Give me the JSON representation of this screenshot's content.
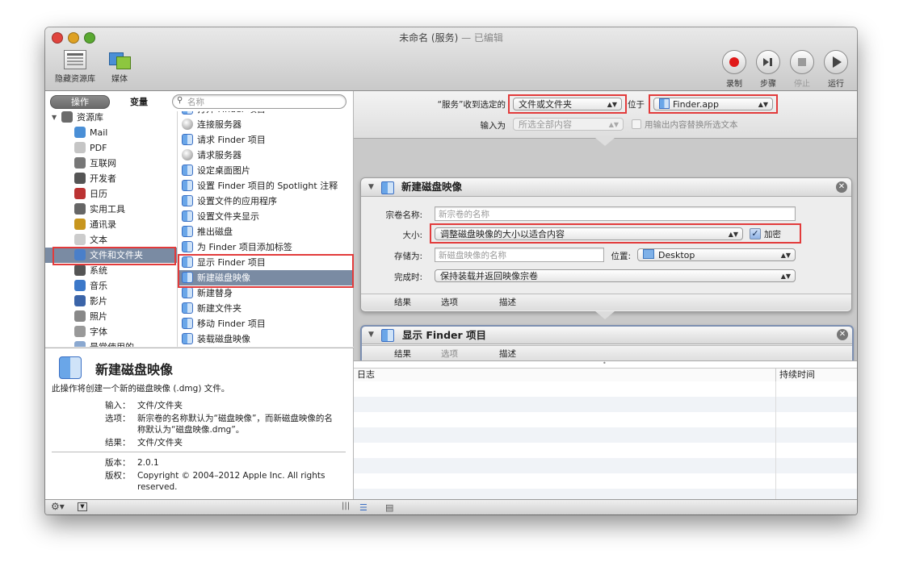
{
  "window": {
    "title": "未命名 (服务)",
    "title_suffix": " — 已编辑"
  },
  "toolbar": {
    "hide_library": "隐藏资源库",
    "media": "媒体",
    "record": "录制",
    "step": "步骤",
    "stop": "停止",
    "run": "运行"
  },
  "library": {
    "tab_actions": "操作",
    "tab_variables": "变量",
    "search_placeholder": "名称",
    "categories": [
      {
        "label": "资源库",
        "icon": "library-icon"
      },
      {
        "label": "Mail",
        "icon": "mail-icon"
      },
      {
        "label": "PDF",
        "icon": "pdf-icon"
      },
      {
        "label": "互联网",
        "icon": "internet-icon"
      },
      {
        "label": "开发者",
        "icon": "developer-icon"
      },
      {
        "label": "日历",
        "icon": "calendar-icon"
      },
      {
        "label": "实用工具",
        "icon": "utilities-icon"
      },
      {
        "label": "通讯录",
        "icon": "contacts-icon"
      },
      {
        "label": "文本",
        "icon": "text-icon"
      },
      {
        "label": "文件和文件夹",
        "icon": "files-folders-icon"
      },
      {
        "label": "系统",
        "icon": "system-icon"
      },
      {
        "label": "音乐",
        "icon": "music-icon"
      },
      {
        "label": "影片",
        "icon": "movies-icon"
      },
      {
        "label": "照片",
        "icon": "photos-icon"
      },
      {
        "label": "字体",
        "icon": "fonts-icon"
      },
      {
        "label": "最常使用的",
        "icon": "folder-icon"
      }
    ],
    "actions": [
      {
        "label": "打开 Finder 项目",
        "icon": "finder-icon"
      },
      {
        "label": "连接服务器",
        "icon": "globe-icon"
      },
      {
        "label": "请求 Finder 项目",
        "icon": "finder-icon"
      },
      {
        "label": "请求服务器",
        "icon": "globe-icon"
      },
      {
        "label": "设定桌面图片",
        "icon": "finder-icon"
      },
      {
        "label": "设置 Finder 项目的 Spotlight 注释",
        "icon": "finder-icon"
      },
      {
        "label": "设置文件的应用程序",
        "icon": "finder-icon"
      },
      {
        "label": "设置文件夹显示",
        "icon": "finder-icon"
      },
      {
        "label": "推出磁盘",
        "icon": "finder-icon"
      },
      {
        "label": "为 Finder 项目添加标签",
        "icon": "finder-icon"
      },
      {
        "label": "显示 Finder 项目",
        "icon": "finder-icon"
      },
      {
        "label": "新建磁盘映像",
        "icon": "finder-icon"
      },
      {
        "label": "新建替身",
        "icon": "finder-icon"
      },
      {
        "label": "新建文件夹",
        "icon": "finder-icon"
      },
      {
        "label": "移动 Finder 项目",
        "icon": "finder-icon"
      },
      {
        "label": "装载磁盘映像",
        "icon": "finder-icon"
      }
    ]
  },
  "description": {
    "title": "新建磁盘映像",
    "summary": "此操作将创建一个新的磁盘映像 (.dmg) 文件。",
    "input_label": "输入：",
    "input_value": "文件/文件夹",
    "options_label": "选项：",
    "options_value": "新宗卷的名称默认为“磁盘映像”，而新磁盘映像的名称默认为“磁盘映像.dmg”。",
    "result_label": "结果：",
    "result_value": "文件/文件夹",
    "version_label": "版本：",
    "version_value": "2.0.1",
    "copyright_label": "版权：",
    "copyright_value": "Copyright © 2004–2012 Apple Inc.  All rights reserved."
  },
  "workflow": {
    "service_label": "“服务”收到选定的",
    "service_value": "文件或文件夹",
    "in_label": "位于",
    "in_value": "Finder.app",
    "input_is_label": "输入为",
    "input_is_value": "所选全部内容",
    "replace_label": "用输出内容替换所选文本",
    "action1": {
      "title": "新建磁盘映像",
      "volume_label": "宗卷名称:",
      "volume_placeholder": "新宗卷的名称",
      "size_label": "大小:",
      "size_value": "调整磁盘映像的大小以适合内容",
      "encrypt_label": "加密",
      "encrypt_checked": true,
      "save_as_label": "存储为:",
      "save_as_placeholder": "新磁盘映像的名称",
      "where_label": "位置:",
      "where_value": "Desktop",
      "when_done_label": "完成时:",
      "when_done_value": "保持装载并返回映像宗卷",
      "tab_results": "结果",
      "tab_options": "选项",
      "tab_description": "描述"
    },
    "action2": {
      "title": "显示 Finder 项目",
      "tab_results": "结果",
      "tab_options": "选项",
      "tab_description": "描述"
    }
  },
  "log": {
    "col_log": "日志",
    "col_duration": "持续时间"
  },
  "colors": {
    "highlight": "#e23b3b",
    "selected_row": "#7a8ba3",
    "accent_blue": "#3a6fc4"
  }
}
